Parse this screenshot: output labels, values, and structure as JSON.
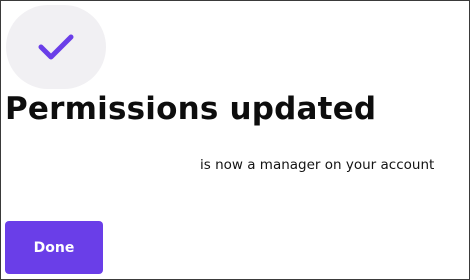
{
  "icon": "check-icon",
  "title": "Permissions updated",
  "message": "is now a manager on your account",
  "done_button_label": "Done",
  "colors": {
    "accent": "#6a3ee8",
    "icon_bg": "#f1f0f3",
    "text": "#0d0d0d"
  }
}
